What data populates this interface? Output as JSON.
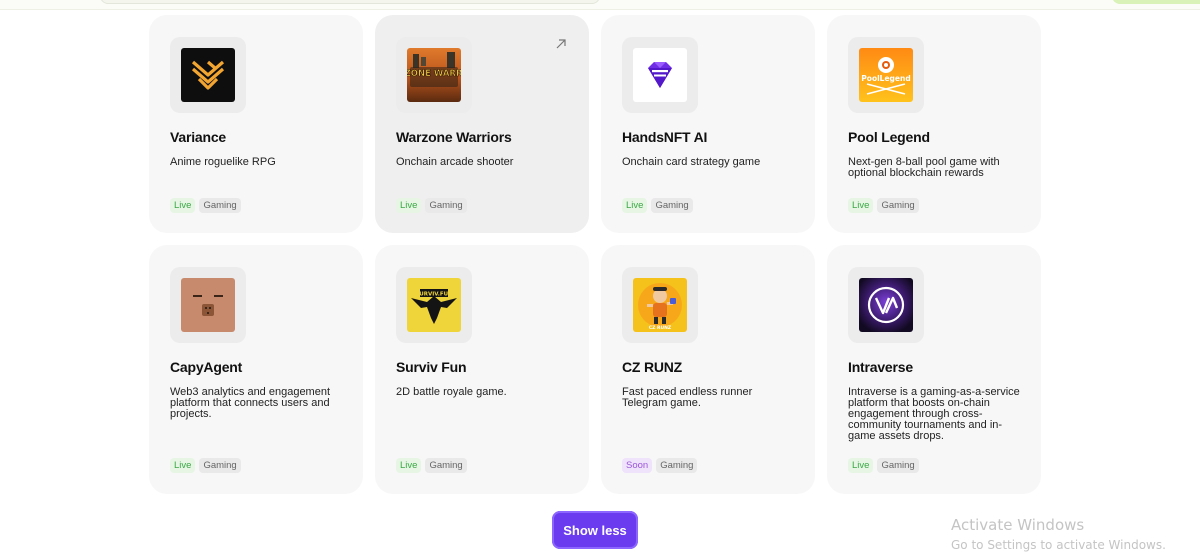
{
  "games": [
    {
      "name": "Variance",
      "description": "Anime roguelike RPG",
      "status": "Live",
      "category": "Gaming",
      "icon": "variance-logo-icon"
    },
    {
      "name": "Warzone Warriors",
      "description": "Onchain arcade shooter",
      "status": "Live",
      "category": "Gaming",
      "icon": "warzone-warriors-logo-icon",
      "logo_text": "WARZONE WARRIORS"
    },
    {
      "name": "HandsNFT AI",
      "description": "Onchain card strategy game",
      "status": "Live",
      "category": "Gaming",
      "icon": "handsnft-diamond-logo-icon"
    },
    {
      "name": "Pool Legend",
      "description": "Next-gen 8-ball pool game with optional blockchain rewards",
      "status": "Live",
      "category": "Gaming",
      "icon": "pool-legend-logo-icon",
      "logo_text": "PoolLegend"
    },
    {
      "name": "CapyAgent",
      "description": "Web3 analytics and engagement platform that connects users and projects.",
      "status": "Live",
      "category": "Gaming",
      "icon": "capybara-logo-icon"
    },
    {
      "name": "Surviv Fun",
      "description": "2D battle royale game.",
      "status": "Live",
      "category": "Gaming",
      "icon": "surviv-fun-eagle-logo-icon",
      "logo_text": "SURVIV.FUN"
    },
    {
      "name": "CZ RUNZ",
      "description": "Fast paced endless runner Telegram game.",
      "status": "Soon",
      "category": "Gaming",
      "icon": "cz-runz-character-logo-icon",
      "logo_text": "CZ RUNZ"
    },
    {
      "name": "Intraverse",
      "description": "Intraverse is a gaming-as-a-service platform that boosts on-chain engagement through cross-community tournaments and in-game assets drops.",
      "status": "Live",
      "category": "Gaming",
      "icon": "intraverse-logo-icon"
    }
  ],
  "show_less_label": "Show less",
  "watermark": {
    "title": "Activate Windows",
    "subtitle": "Go to Settings to activate Windows."
  },
  "colors": {
    "accent": "#6b3bf0",
    "live": "#3aa845",
    "soon": "#9b56d9",
    "card": "#f7f7f7"
  }
}
